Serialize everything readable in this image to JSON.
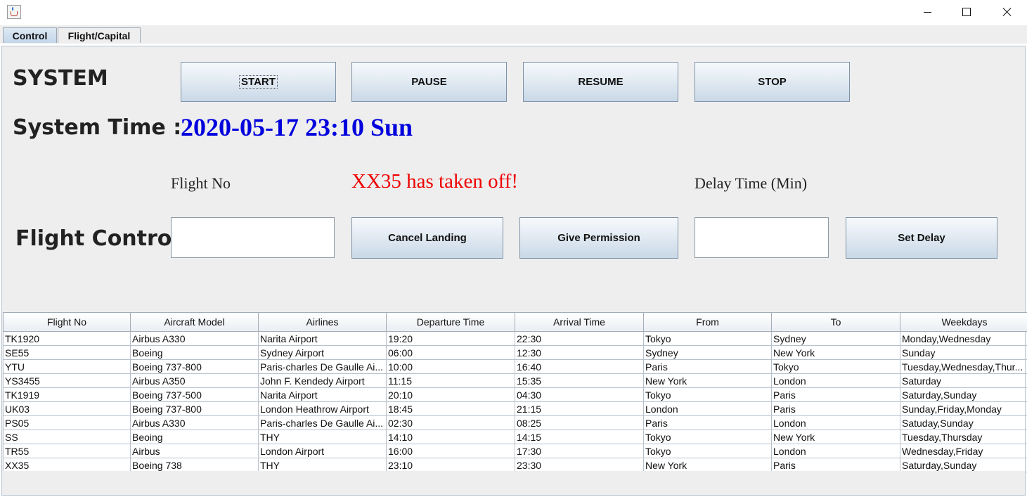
{
  "tabs": [
    "Control",
    "Flight/Capital"
  ],
  "system": {
    "label": "SYSTEM",
    "buttons": [
      "START",
      "PAUSE",
      "RESUME",
      "STOP"
    ],
    "time_label": "System Time :",
    "time_value": "2020-05-17 23:10 Sun"
  },
  "flight_control": {
    "label": "Flight Control",
    "flight_no_label": "Flight No",
    "status_message": "XX35 has taken off!",
    "delay_label": "Delay Time (Min)",
    "flight_no_value": "",
    "delay_value": "",
    "cancel_button": "Cancel Landing",
    "permission_button": "Give Permission",
    "delay_button": "Set Delay"
  },
  "colors": {
    "time": "#0000dd",
    "status": "#ee0000"
  },
  "table": {
    "columns": [
      "Flight No",
      "Aircraft Model",
      "Airlines",
      "Departure Time",
      "Arrival Time",
      "From",
      "To",
      "Weekdays"
    ],
    "rows": [
      [
        "TK1920",
        "Airbus A330",
        "Narita Airport",
        "19:20",
        "22:30",
        "Tokyo",
        "Sydney",
        "Monday,Wednesday"
      ],
      [
        "SE55",
        "Boeing",
        "Sydney Airport",
        "06:00",
        "12:30",
        "Sydney",
        "New York",
        "Sunday"
      ],
      [
        "YTU",
        "Boeing 737-800",
        "Paris-charles De Gaulle Ai...",
        "10:00",
        "16:40",
        "Paris",
        "Tokyo",
        "Tuesday,Wednesday,Thur..."
      ],
      [
        "YS3455",
        "Airbus A350",
        "John F. Kendedy Airport",
        "11:15",
        "15:35",
        "New York",
        "London",
        "Saturday"
      ],
      [
        "TK1919",
        "Boeing 737-500",
        "Narita Airport",
        "20:10",
        "04:30",
        "Tokyo",
        "Paris",
        "Saturday,Sunday"
      ],
      [
        "UK03",
        "Boeing 737-800",
        "London Heathrow Airport",
        "18:45",
        "21:15",
        "London",
        "Paris",
        "Sunday,Friday,Monday"
      ],
      [
        "PS05",
        "Airbus A330",
        "Paris-charles De Gaulle Ai...",
        "02:30",
        "08:25",
        "Paris",
        "London",
        "Satuday,Sunday"
      ],
      [
        "SS",
        "Beoing",
        "THY",
        "14:10",
        "14:15",
        "Tokyo",
        "New York",
        "Tuesday,Thursday"
      ],
      [
        "TR55",
        "Airbus",
        "London Airport",
        "16:00",
        "17:30",
        "Tokyo",
        "London",
        "Wednesday,Friday"
      ],
      [
        "XX35",
        "Boeing 738",
        "THY",
        "23:10",
        "23:30",
        "New York",
        "Paris",
        "Saturday,Sunday"
      ]
    ]
  }
}
